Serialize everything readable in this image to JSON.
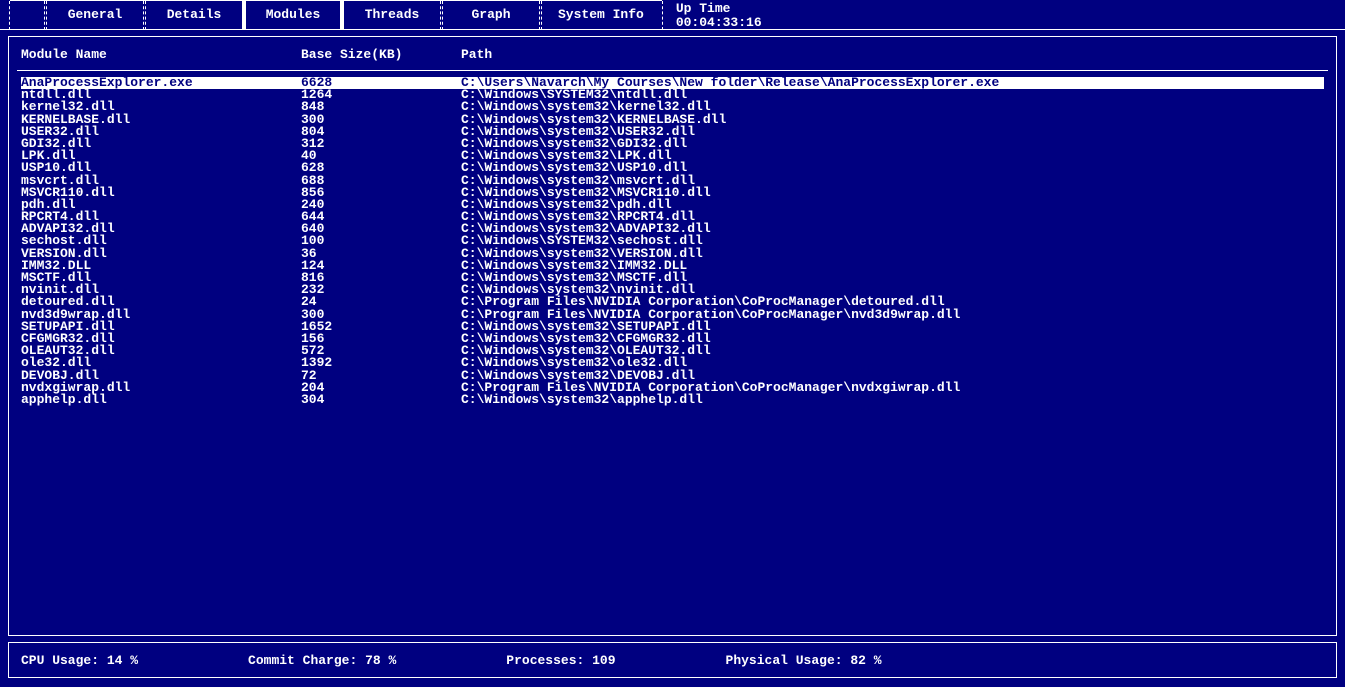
{
  "tabs": [
    {
      "label": "General"
    },
    {
      "label": "Details"
    },
    {
      "label": "Modules",
      "active": true
    },
    {
      "label": "Threads"
    },
    {
      "label": "Graph"
    },
    {
      "label": "System Info"
    }
  ],
  "uptime": {
    "label": "Up Time",
    "value": "00:04:33:16"
  },
  "columns": {
    "name": "Module Name",
    "size": "Base Size(KB)",
    "path": "Path"
  },
  "rows": [
    {
      "name": "AnaProcessExplorer.exe",
      "size": "6628",
      "path": "C:\\Users\\Navarch\\My Courses\\New folder\\Release\\AnaProcessExplorer.exe",
      "selected": true
    },
    {
      "name": "ntdll.dll",
      "size": "1264",
      "path": "C:\\Windows\\SYSTEM32\\ntdll.dll"
    },
    {
      "name": "kernel32.dll",
      "size": "848",
      "path": "C:\\Windows\\system32\\kernel32.dll"
    },
    {
      "name": "KERNELBASE.dll",
      "size": "300",
      "path": "C:\\Windows\\system32\\KERNELBASE.dll"
    },
    {
      "name": "USER32.dll",
      "size": "804",
      "path": "C:\\Windows\\system32\\USER32.dll"
    },
    {
      "name": "GDI32.dll",
      "size": "312",
      "path": "C:\\Windows\\system32\\GDI32.dll"
    },
    {
      "name": "LPK.dll",
      "size": "40",
      "path": "C:\\Windows\\system32\\LPK.dll"
    },
    {
      "name": "USP10.dll",
      "size": "628",
      "path": "C:\\Windows\\system32\\USP10.dll"
    },
    {
      "name": "msvcrt.dll",
      "size": "688",
      "path": "C:\\Windows\\system32\\msvcrt.dll"
    },
    {
      "name": "MSVCR110.dll",
      "size": "856",
      "path": "C:\\Windows\\system32\\MSVCR110.dll"
    },
    {
      "name": "pdh.dll",
      "size": "240",
      "path": "C:\\Windows\\system32\\pdh.dll"
    },
    {
      "name": "RPCRT4.dll",
      "size": "644",
      "path": "C:\\Windows\\system32\\RPCRT4.dll"
    },
    {
      "name": "ADVAPI32.dll",
      "size": "640",
      "path": "C:\\Windows\\system32\\ADVAPI32.dll"
    },
    {
      "name": "sechost.dll",
      "size": "100",
      "path": "C:\\Windows\\SYSTEM32\\sechost.dll"
    },
    {
      "name": "VERSION.dll",
      "size": "36",
      "path": "C:\\Windows\\system32\\VERSION.dll"
    },
    {
      "name": "IMM32.DLL",
      "size": "124",
      "path": "C:\\Windows\\system32\\IMM32.DLL"
    },
    {
      "name": "MSCTF.dll",
      "size": "816",
      "path": "C:\\Windows\\system32\\MSCTF.dll"
    },
    {
      "name": "nvinit.dll",
      "size": "232",
      "path": "C:\\Windows\\system32\\nvinit.dll"
    },
    {
      "name": "detoured.dll",
      "size": "24",
      "path": "C:\\Program Files\\NVIDIA Corporation\\CoProcManager\\detoured.dll"
    },
    {
      "name": "nvd3d9wrap.dll",
      "size": "300",
      "path": "C:\\Program Files\\NVIDIA Corporation\\CoProcManager\\nvd3d9wrap.dll"
    },
    {
      "name": "SETUPAPI.dll",
      "size": "1652",
      "path": "C:\\Windows\\system32\\SETUPAPI.dll"
    },
    {
      "name": "CFGMGR32.dll",
      "size": "156",
      "path": "C:\\Windows\\system32\\CFGMGR32.dll"
    },
    {
      "name": "OLEAUT32.dll",
      "size": "572",
      "path": "C:\\Windows\\system32\\OLEAUT32.dll"
    },
    {
      "name": "ole32.dll",
      "size": "1392",
      "path": "C:\\Windows\\system32\\ole32.dll"
    },
    {
      "name": "DEVOBJ.dll",
      "size": "72",
      "path": "C:\\Windows\\system32\\DEVOBJ.dll"
    },
    {
      "name": "nvdxgiwrap.dll",
      "size": "204",
      "path": "C:\\Program Files\\NVIDIA Corporation\\CoProcManager\\nvdxgiwrap.dll"
    },
    {
      "name": "apphelp.dll",
      "size": "304",
      "path": "C:\\Windows\\system32\\apphelp.dll"
    }
  ],
  "status": {
    "cpu_label": "CPU Usage:",
    "cpu_value": "14 %",
    "commit_label": "Commit Charge:",
    "commit_value": "78 %",
    "proc_label": "Processes:",
    "proc_value": "109",
    "phys_label": "Physical Usage:",
    "phys_value": "82 %"
  }
}
